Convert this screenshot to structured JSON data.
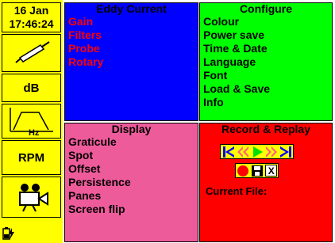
{
  "sidebar": {
    "date": "16 Jan",
    "time": "17:46:24",
    "db_label": "dB",
    "hz_label": "Hz",
    "rpm_label": "RPM"
  },
  "eddy": {
    "title": "Eddy Current",
    "items": [
      "Gain",
      "Filters",
      "Probe",
      "Rotary"
    ]
  },
  "configure": {
    "title": "Configure",
    "items": [
      "Colour",
      "Power save",
      "Time & Date",
      "Language",
      "Font",
      "Load & Save",
      "Info"
    ]
  },
  "display": {
    "title": "Display",
    "items": [
      "Graticule",
      "Spot",
      "Offset",
      "Persistence",
      "Panes",
      "Screen flip"
    ]
  },
  "record": {
    "title": "Record & Replay",
    "current_file_label": "Current File:",
    "buttons_row1": [
      "skip-start-icon",
      "rewind-icon",
      "play-icon",
      "fast-forward-icon",
      "skip-end-icon"
    ],
    "buttons_row2": [
      "record-icon",
      "save-icon",
      "delete-icon"
    ],
    "delete_glyph": "X"
  },
  "colors": {
    "sidebar": "#ffff00",
    "eddy": "#0000ff",
    "configure": "#00ff00",
    "display": "#ee5b9b",
    "record": "#ff0000",
    "eddy_text": "#ff0000",
    "active_text": "#000000"
  }
}
